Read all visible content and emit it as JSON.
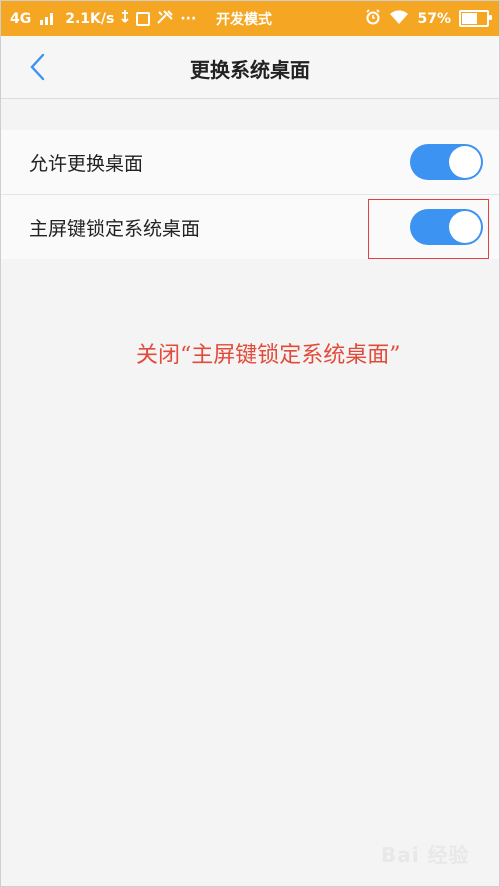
{
  "status_bar": {
    "network": "4G",
    "speed": "2.1K/s",
    "dots": "···",
    "mode": "开发模式",
    "battery_percent": "57%",
    "battery_level": 0.57,
    "color": "#f5a623"
  },
  "header": {
    "title": "更换系统桌面",
    "back_icon": "chevron-left-icon"
  },
  "settings": {
    "items": [
      {
        "label": "允许更换桌面",
        "enabled": true
      },
      {
        "label": "主屏键锁定系统桌面",
        "enabled": true
      }
    ],
    "accent_color": "#3d93f1"
  },
  "annotation": {
    "text": "关闭“主屏键锁定系统桌面”",
    "color": "#e24b3b"
  },
  "watermark": {
    "text": "Bai 经验"
  }
}
